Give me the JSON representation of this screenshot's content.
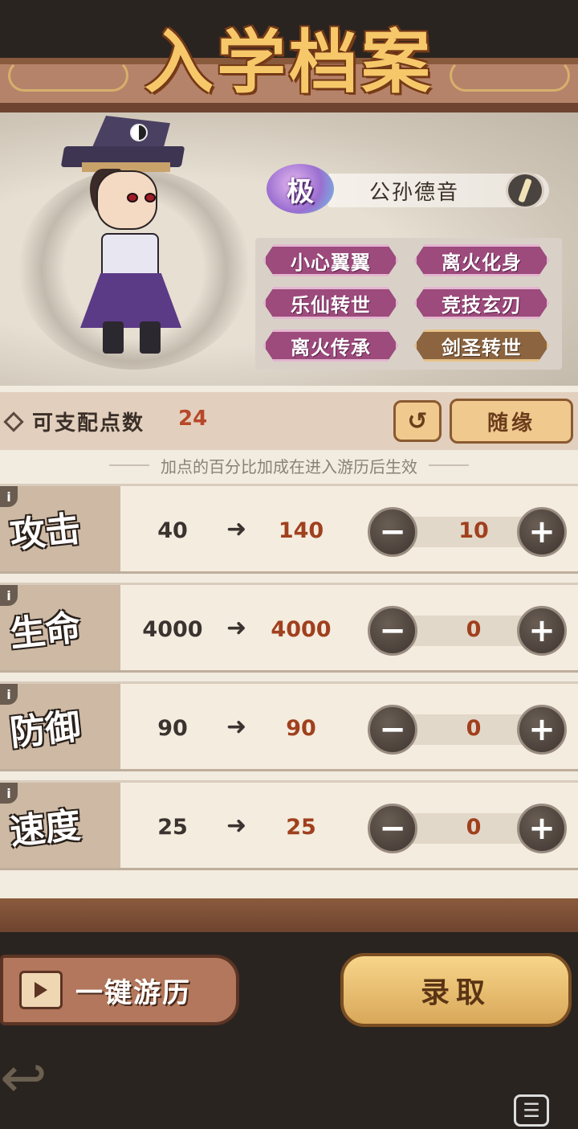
{
  "top_corner_text": "攻",
  "title": "入学档案",
  "character": {
    "rank": "极",
    "name": "公孙德音",
    "traits": [
      "小心翼翼",
      "离火化身",
      "乐仙转世",
      "竞技玄刃",
      "离火传承",
      "剑圣转世"
    ]
  },
  "points": {
    "label": "可支配点数",
    "value": "24"
  },
  "random_label": "随缘",
  "hint": "加点的百分比加成在进入游历后生效",
  "stats": [
    {
      "name": "攻击",
      "base": "40",
      "new": "140",
      "alloc": "10"
    },
    {
      "name": "生命",
      "base": "4000",
      "new": "4000",
      "alloc": "0"
    },
    {
      "name": "防御",
      "base": "90",
      "new": "90",
      "alloc": "0"
    },
    {
      "name": "速度",
      "base": "25",
      "new": "25",
      "alloc": "0"
    }
  ],
  "tour_label": "一键游历",
  "enroll_label": "录取",
  "icons": {
    "info": "info-icon",
    "reset": "undo-icon",
    "minus": "minus-icon",
    "plus": "plus-icon",
    "tv": "tv-play-icon",
    "back": "back-arrow-icon",
    "chat": "chat-icon"
  }
}
